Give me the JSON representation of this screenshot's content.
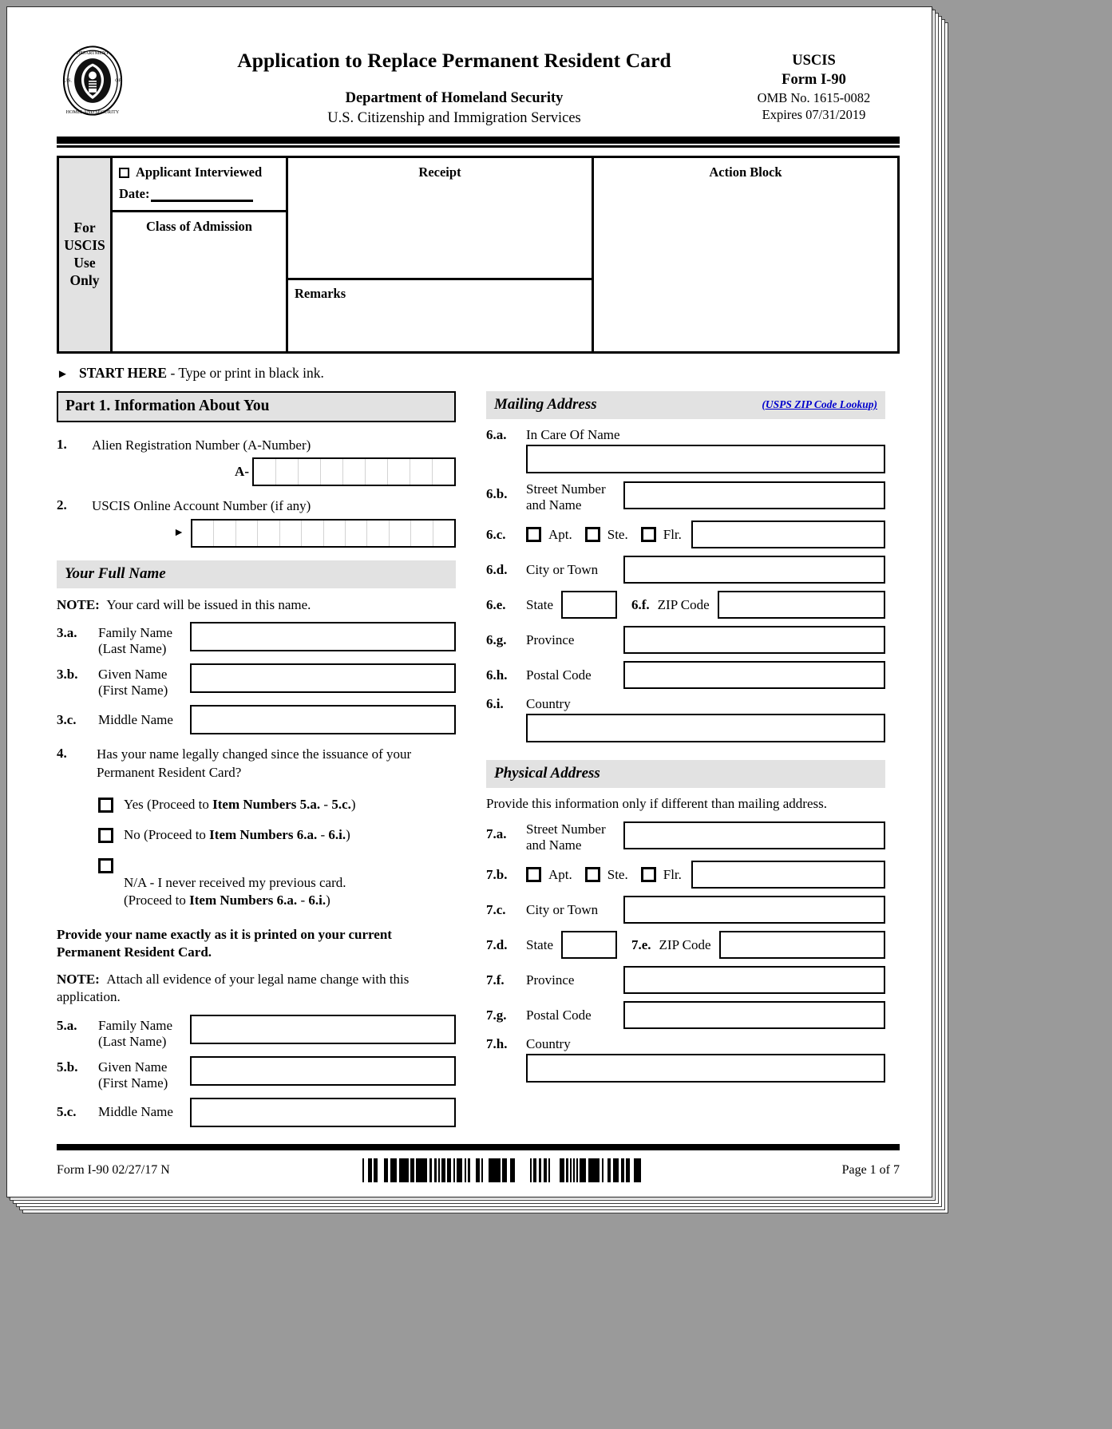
{
  "header": {
    "seal_alt": "dhs-seal-icon",
    "title": "Application to Replace Permanent Resident Card",
    "department": "Department of Homeland Security",
    "agency": "U.S. Citizenship and Immigration Services",
    "agency_short": "USCIS",
    "form_number": "Form I-90",
    "omb": "OMB No. 1615-0082",
    "expires": "Expires 07/31/2019"
  },
  "uscis_use": {
    "label": "For USCIS Use Only",
    "applicant_interviewed": "Applicant Interviewed",
    "date_label": "Date:",
    "class_of_admission": "Class of Admission",
    "remarks": "Remarks",
    "receipt": "Receipt",
    "action_block": "Action Block"
  },
  "start_here": {
    "arrow": "►",
    "bold": "START HERE",
    "rest": "- Type or print in black ink."
  },
  "part1": {
    "heading": "Part 1.  Information About You",
    "item1": {
      "num": "1.",
      "label": "Alien Registration Number (A-Number)",
      "prefix": "A-",
      "cells": 9
    },
    "item2": {
      "num": "2.",
      "label": "USCIS Online Account Number (if any)",
      "arrow": "►",
      "cells": 12
    },
    "full_name": {
      "heading": "Your Full Name",
      "note_bold": "NOTE:",
      "note_text": "Your card will be issued in this name.",
      "rows": [
        {
          "num": "3.a.",
          "label1": "Family Name",
          "label2": "(Last Name)"
        },
        {
          "num": "3.b.",
          "label1": "Given Name",
          "label2": "(First Name)"
        },
        {
          "num": "3.c.",
          "label1": "Middle Name",
          "label2": ""
        }
      ]
    },
    "item4": {
      "num": "4.",
      "question": "Has your name legally changed since the issuance of your Permanent Resident Card?",
      "options": [
        {
          "pre": "Yes (Proceed to ",
          "bold1": "Item Numbers 5.a.",
          "mid": " - ",
          "bold2": "5.c.",
          "post": ")"
        },
        {
          "pre": "No (Proceed to ",
          "bold1": "Item Numbers 6.a.",
          "mid": " - ",
          "bold2": "6.i.",
          "post": ")"
        },
        {
          "pre": "N/A - I never received my previous card.\n(Proceed to ",
          "bold1": "Item Numbers 6.a.",
          "mid": " - ",
          "bold2": "6.i.",
          "post": ")"
        }
      ]
    },
    "provide_exactly": "Provide your name exactly as it is printed on your current Permanent Resident Card.",
    "note2_bold": "NOTE:",
    "note2_text": "Attach all evidence of your legal name change with this application.",
    "name_rows5": [
      {
        "num": "5.a.",
        "label1": "Family Name",
        "label2": "(Last Name)"
      },
      {
        "num": "5.b.",
        "label1": "Given Name",
        "label2": "(First Name)"
      },
      {
        "num": "5.c.",
        "label1": "Middle Name",
        "label2": ""
      }
    ]
  },
  "mailing_address": {
    "heading": "Mailing Address",
    "zip_lookup": "(USPS ZIP Code Lookup)",
    "rows": [
      {
        "num": "6.a.",
        "label": "In Care Of Name",
        "type": "stacked"
      },
      {
        "num": "6.b.",
        "label": "Street Number\nand Name",
        "type": "inline"
      },
      {
        "num": "6.c.",
        "label": "",
        "type": "checks",
        "checks": [
          "Apt.",
          "Ste.",
          "Flr."
        ]
      },
      {
        "num": "6.d.",
        "label": "City or Town",
        "type": "inline"
      },
      {
        "num": "6.e.",
        "label": "State",
        "type": "state_zip",
        "label2num": "6.f.",
        "label2": "ZIP Code"
      },
      {
        "num": "6.g.",
        "label": "Province",
        "type": "inline"
      },
      {
        "num": "6.h.",
        "label": "Postal Code",
        "type": "inline"
      },
      {
        "num": "6.i.",
        "label": "Country",
        "type": "stacked"
      }
    ]
  },
  "physical_address": {
    "heading": "Physical Address",
    "note": "Provide this information only if different than mailing address.",
    "rows": [
      {
        "num": "7.a.",
        "label": "Street Number\nand Name",
        "type": "inline"
      },
      {
        "num": "7.b.",
        "label": "",
        "type": "checks",
        "checks": [
          "Apt.",
          "Ste.",
          "Flr."
        ]
      },
      {
        "num": "7.c.",
        "label": "City or Town",
        "type": "inline"
      },
      {
        "num": "7.d.",
        "label": "State",
        "type": "state_zip",
        "label2num": "7.e.",
        "label2": "ZIP Code"
      },
      {
        "num": "7.f.",
        "label": "Province",
        "type": "inline"
      },
      {
        "num": "7.g.",
        "label": "Postal Code",
        "type": "inline"
      },
      {
        "num": "7.h.",
        "label": "Country",
        "type": "stacked"
      }
    ]
  },
  "footer": {
    "form_line": "Form I-90   02/27/17   N",
    "barcode_alt": "barcode",
    "page_number": "Page 1 of 7"
  },
  "colors": {
    "shade": "#e2e2e2",
    "link": "#0000cc",
    "rule": "#000000"
  }
}
